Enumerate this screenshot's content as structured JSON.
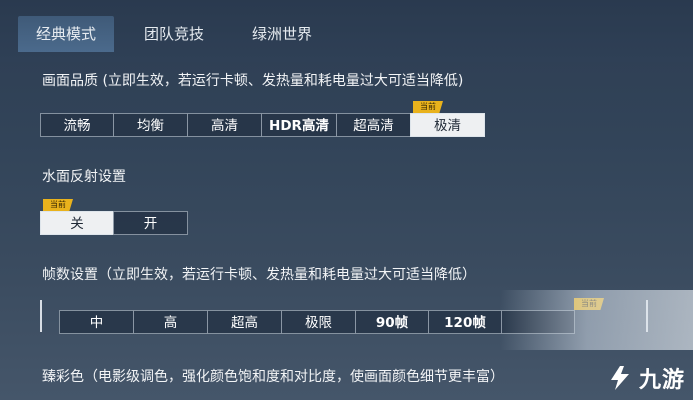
{
  "tabs": [
    {
      "label": "经典模式"
    },
    {
      "label": "团队竞技"
    },
    {
      "label": "绿洲世界"
    }
  ],
  "graphics": {
    "title": "画面品质 (立即生效，若运行卡顿、发热量和耗电量过大可适当降低)",
    "options": [
      "流畅",
      "均衡",
      "高清",
      "HDR高清",
      "超高清",
      "极清"
    ],
    "selected": "极清",
    "badge": "当前"
  },
  "water": {
    "title": "水面反射设置",
    "options": [
      "关",
      "开"
    ],
    "selected": "关",
    "badge": "当前"
  },
  "fps": {
    "title": "帧数设置（立即生效，若运行卡顿、发热量和耗电量过大可适当降低）",
    "options": [
      "中",
      "高",
      "超高",
      "极限",
      "90帧",
      "120帧"
    ],
    "badge": "当前"
  },
  "color": {
    "title": "臻彩色（电影级调色，强化颜色饱和度和对比度，使画面颜色细节更丰富）"
  },
  "watermark": {
    "text": "九游"
  }
}
